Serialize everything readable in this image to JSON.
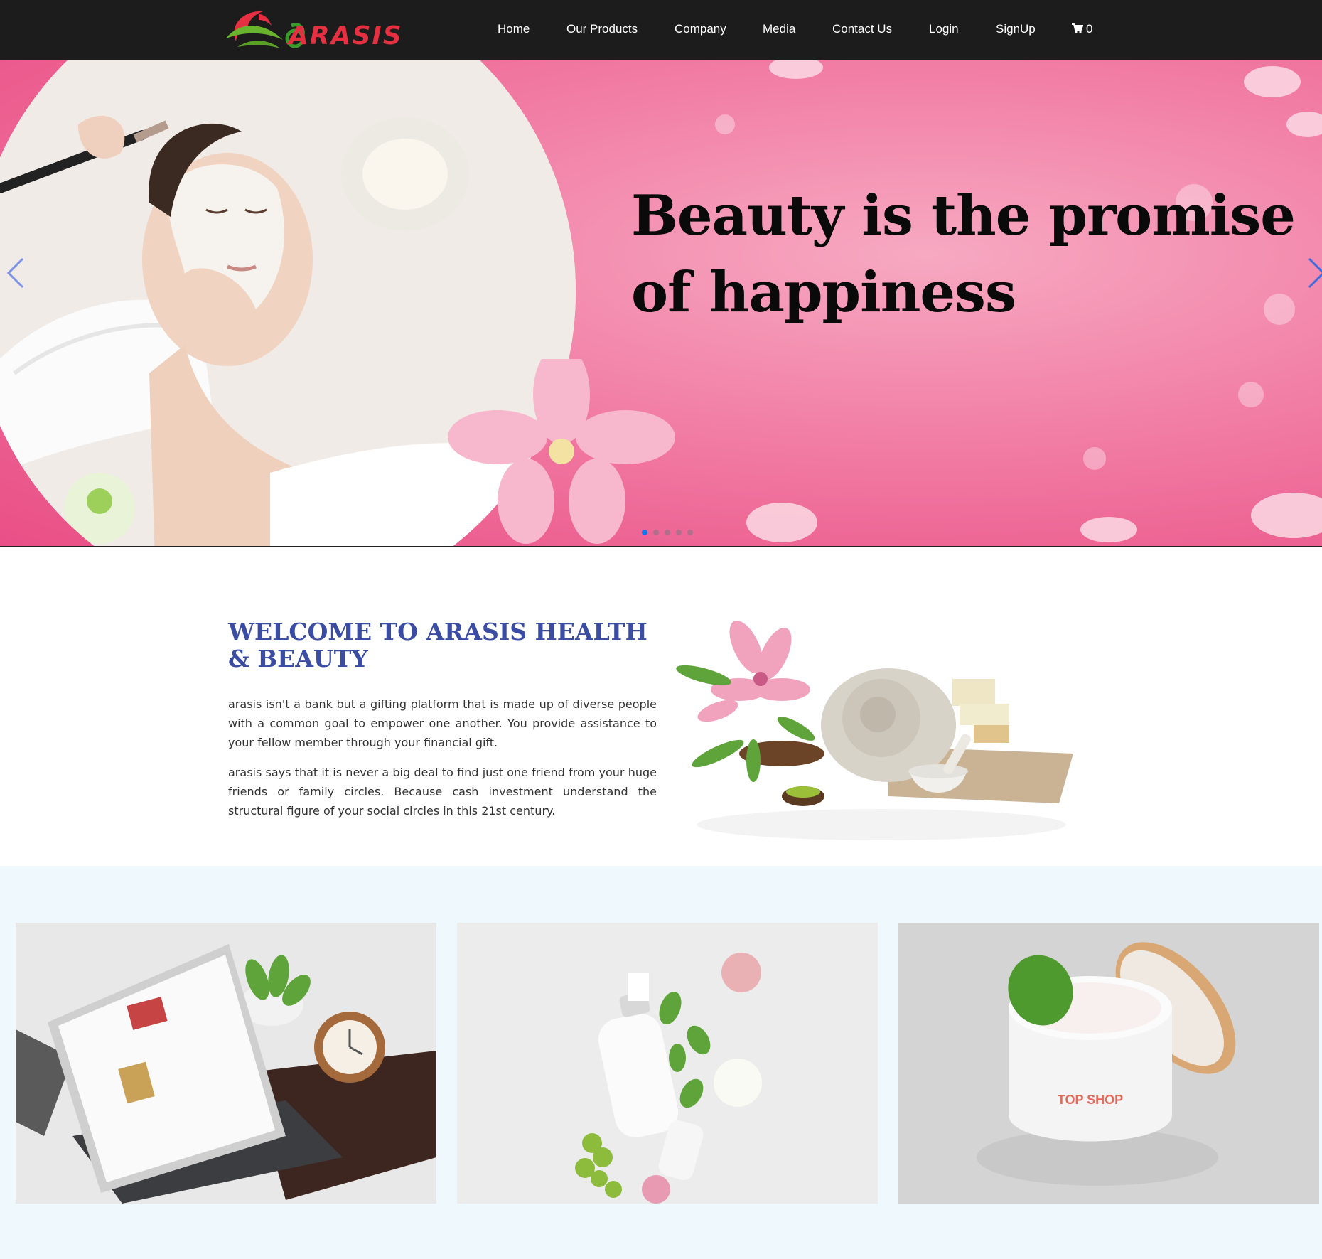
{
  "header": {
    "logo_text": "ARASIS",
    "nav": [
      {
        "label": "Home"
      },
      {
        "label": "Our Products"
      },
      {
        "label": "Company"
      },
      {
        "label": "Media"
      },
      {
        "label": "Contact Us"
      },
      {
        "label": "Login"
      },
      {
        "label": "SignUp"
      }
    ],
    "cart": {
      "icon": "cart-icon",
      "count": "0"
    }
  },
  "hero": {
    "title": "Beauty is the promise of happiness",
    "prev_icon": "chevron-left-icon",
    "next_icon": "chevron-right-icon",
    "slides": 5,
    "active_slide": 1
  },
  "welcome": {
    "title": "WELCOME TO ARASIS HEALTH & BEAUTY",
    "paragraph1": "arasis isn't a bank but a gifting platform that is made up of diverse people with a common goal to empower one another. You provide assistance to your fellow member through your financial gift.",
    "paragraph2": "arasis says that it is never a big deal to find just one friend from your huge friends or family circles. Because cash investment understand the structural figure of your social circles in this 21st century."
  },
  "gallery": {
    "card3_label": "TOP SHOP"
  },
  "colors": {
    "navbar": "#1c1c1c",
    "hero_pink": "#f282a8",
    "title_blue": "#3b4ca3",
    "gallery_bg": "#eff8fd",
    "brand_red": "#e63042",
    "brand_green": "#6ab42d"
  }
}
